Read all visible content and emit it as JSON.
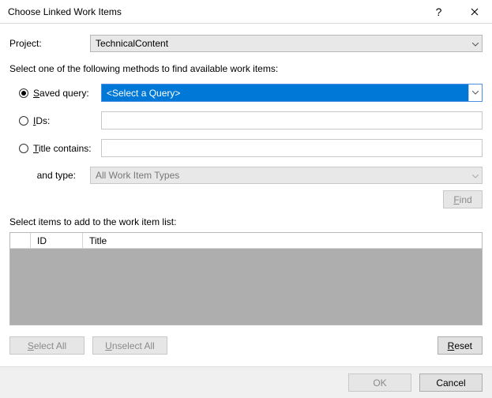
{
  "titlebar": {
    "title": "Choose Linked Work Items"
  },
  "labels": {
    "project": "Project:",
    "instruction": "Select one of the following methods to find available work items:"
  },
  "project": {
    "value": "TechnicalContent"
  },
  "methods": {
    "savedQuery": {
      "prefix": "S",
      "suffix": "aved query:",
      "selected": "<Select a Query>"
    },
    "ids": {
      "prefix": "I",
      "suffix": "Ds:",
      "value": ""
    },
    "titleContains": {
      "prefix": "T",
      "suffix": "itle contains:",
      "value": ""
    },
    "andType": {
      "label": "and type:",
      "value": "All Work Item Types"
    }
  },
  "buttons": {
    "find_prefix": "F",
    "find_suffix": "ind",
    "selectAll_prefix": "S",
    "selectAll_suffix": "elect All",
    "unselectAll_prefix": "U",
    "unselectAll_suffix": "nselect All",
    "reset_prefix": "R",
    "reset_suffix": "eset",
    "ok": "OK",
    "cancel": "Cancel"
  },
  "grid": {
    "label": "Select items to add to the work item list:",
    "columns": {
      "id": "ID",
      "title": "Title"
    }
  }
}
